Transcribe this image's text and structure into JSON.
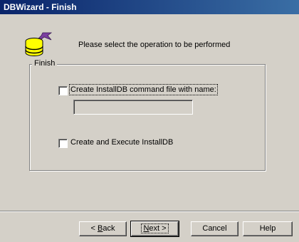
{
  "window": {
    "title": "DBWizard - Finish"
  },
  "instruction": "Please select the operation to be performed",
  "group": {
    "label": "Finish"
  },
  "options": [
    {
      "label": "Create InstallDB command file with name:",
      "checked": false
    },
    {
      "label": "Create and Execute InstallDB",
      "checked": false
    }
  ],
  "filename_field": {
    "value": ""
  },
  "buttons": {
    "back": {
      "accel": "B",
      "rest": "ack",
      "prefix": "< "
    },
    "next": {
      "accel": "N",
      "rest": "ext >"
    },
    "cancel": "Cancel",
    "help": "Help"
  },
  "icon": "wizard-database-icon"
}
